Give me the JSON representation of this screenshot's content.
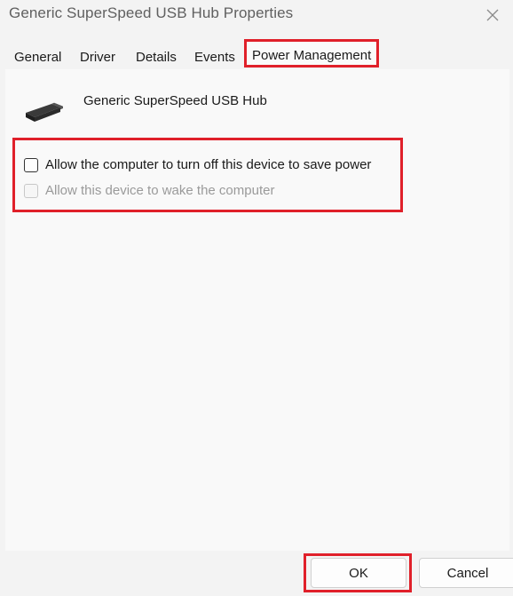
{
  "window": {
    "title": "Generic SuperSpeed USB Hub Properties",
    "close_icon": "close-icon"
  },
  "tabs": [
    {
      "label": "General"
    },
    {
      "label": "Driver"
    },
    {
      "label": "Details"
    },
    {
      "label": "Events"
    },
    {
      "label": "Power Management",
      "active": true
    }
  ],
  "device": {
    "icon": "usb-plug-icon",
    "name": "Generic SuperSpeed USB Hub"
  },
  "options": [
    {
      "label": "Allow the computer to turn off this device to save power",
      "checked": false,
      "enabled": true
    },
    {
      "label": "Allow this device to wake the computer",
      "checked": false,
      "enabled": false
    }
  ],
  "buttons": {
    "ok_label": "OK",
    "cancel_label": "Cancel"
  },
  "colors": {
    "highlight": "#e0202a",
    "background": "#f3f3f3"
  }
}
